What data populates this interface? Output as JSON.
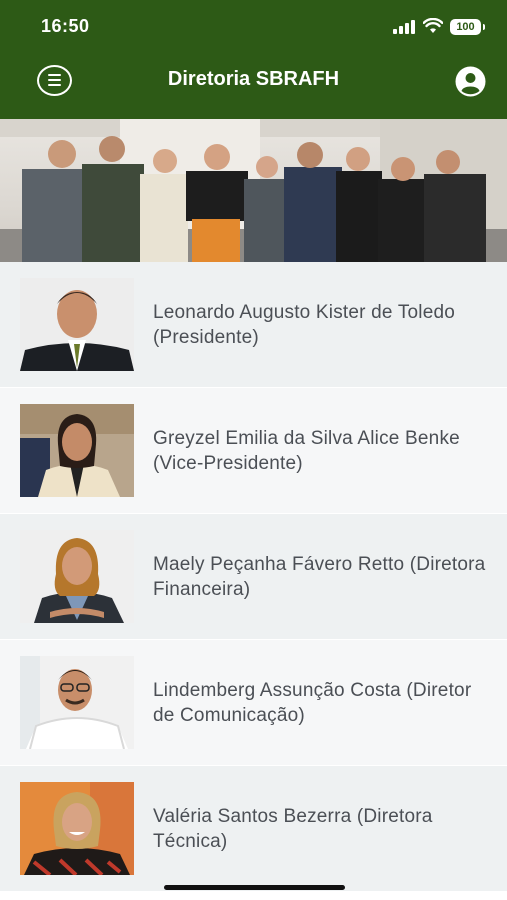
{
  "status_bar": {
    "time": "16:50",
    "battery": "100"
  },
  "header": {
    "title": "Diretoria SBRAFH"
  },
  "icons": {
    "menu": "menu-icon",
    "user": "user-profile-icon",
    "signal": "signal-icon",
    "wifi": "wifi-icon"
  },
  "colors": {
    "header": "#2d5a16",
    "row_alt": "#eef1f2",
    "row_plain": "#f6f7f8"
  },
  "members": [
    {
      "name": "Leonardo Augusto Kister de Toledo (Presidente)"
    },
    {
      "name": "Greyzel Emilia da Silva Alice Benke (Vice-Presidente)"
    },
    {
      "name": "Maely Peçanha Fávero Retto (Diretora Financeira)"
    },
    {
      "name": "Lindemberg Assunção Costa (Diretor de Comunicação)"
    },
    {
      "name": "Valéria Santos Bezerra (Diretora Técnica)"
    }
  ]
}
